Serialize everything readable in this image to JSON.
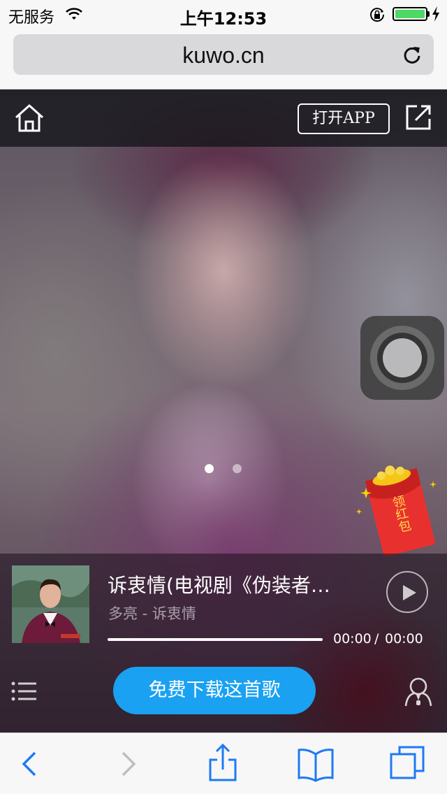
{
  "status_bar": {
    "carrier": "无服务",
    "time": "上午12:53",
    "battery_level": 1.0
  },
  "browser": {
    "url": "kuwo.cn"
  },
  "site_header": {
    "open_app_label": "打开APP"
  },
  "carousel": {
    "total_dots": 2,
    "active_index": 0
  },
  "red_packet": {
    "label": "领红包"
  },
  "player": {
    "title": "诉衷情(电视剧《伪装者…",
    "artist_line": "多亮 - 诉衷情",
    "current_time": "00:00",
    "separator": "/",
    "total_time": "00:00",
    "progress": 0,
    "download_label": "免费下载这首歌"
  },
  "icons": {
    "status": [
      "wifi-icon",
      "orientation-lock-icon",
      "battery-icon",
      "charging-icon"
    ],
    "browser": [
      "reload-icon"
    ],
    "site": [
      "home-icon",
      "share-out-icon"
    ],
    "player": [
      "play-icon",
      "playlist-icon",
      "singer-icon"
    ],
    "toolbar": [
      "back-icon",
      "forward-icon",
      "share-icon",
      "bookmarks-icon",
      "tabs-icon"
    ]
  },
  "colors": {
    "accent": "#1aa1f1",
    "battery": "#4cd964",
    "ios_blue": "#1d7af5",
    "red_packet": "#e8312f"
  }
}
